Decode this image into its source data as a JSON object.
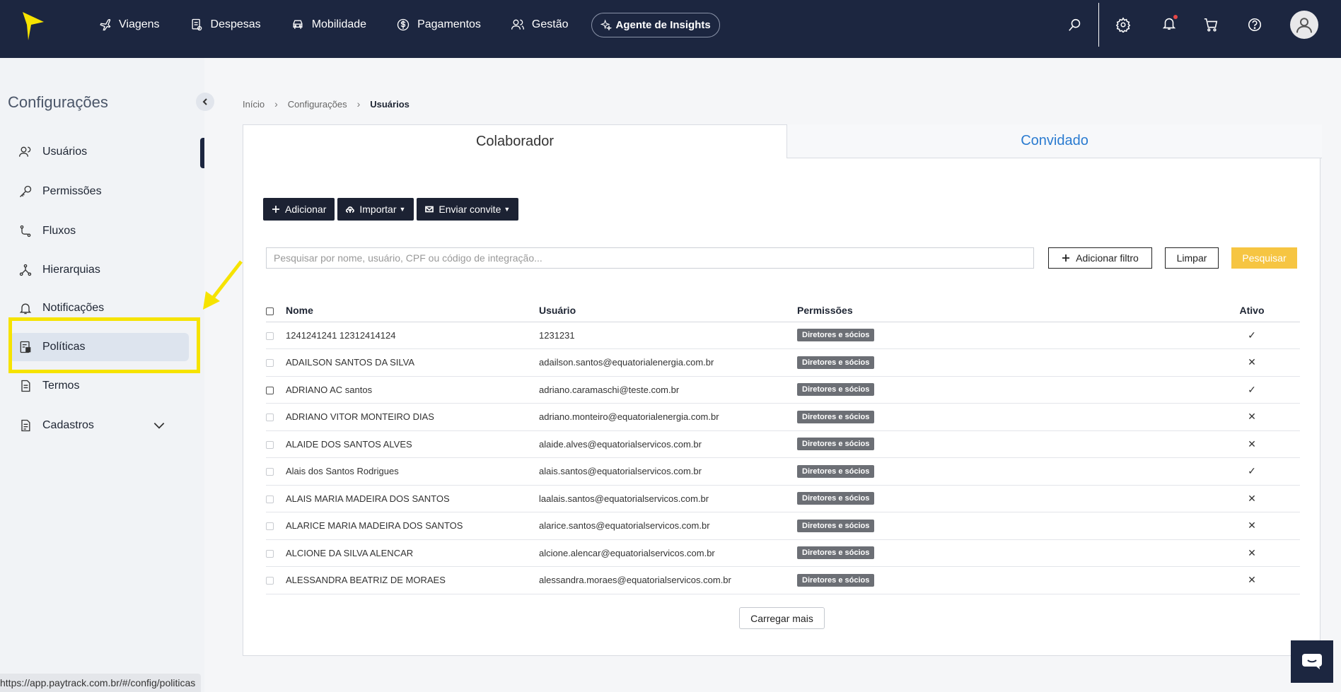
{
  "topnav": {
    "items": [
      {
        "label": "Viagens",
        "icon": "plane-icon"
      },
      {
        "label": "Despesas",
        "icon": "receipt-icon"
      },
      {
        "label": "Mobilidade",
        "icon": "car-icon"
      },
      {
        "label": "Pagamentos",
        "icon": "dollar-icon"
      },
      {
        "label": "Gestão",
        "icon": "users-icon"
      }
    ],
    "insights_label": "Agente de Insights"
  },
  "sidebar": {
    "title": "Configurações",
    "items": [
      {
        "label": "Usuários",
        "icon": "users-icon"
      },
      {
        "label": "Permissões",
        "icon": "key-icon"
      },
      {
        "label": "Fluxos",
        "icon": "flow-icon"
      },
      {
        "label": "Hierarquias",
        "icon": "hierarchy-icon"
      },
      {
        "label": "Notificações",
        "icon": "bell-icon"
      },
      {
        "label": "Políticas",
        "icon": "policy-icon"
      },
      {
        "label": "Termos",
        "icon": "document-icon"
      },
      {
        "label": "Cadastros",
        "icon": "register-icon"
      }
    ]
  },
  "breadcrumb": {
    "home": "Início",
    "config": "Configurações",
    "current": "Usuários"
  },
  "tabs": {
    "colaborador": "Colaborador",
    "convidado": "Convidado"
  },
  "actions": {
    "add": "Adicionar",
    "import": "Importar",
    "invite": "Enviar convite"
  },
  "search": {
    "placeholder": "Pesquisar por nome, usuário, CPF ou código de integração...",
    "add_filter": "Adicionar filtro",
    "clear": "Limpar",
    "submit": "Pesquisar"
  },
  "table": {
    "headers": {
      "name": "Nome",
      "user": "Usuário",
      "permissions": "Permissões",
      "active": "Ativo"
    },
    "rows": [
      {
        "name": "1241241241 12312414124",
        "user": "1231231",
        "permission": "Diretores e sócios",
        "active": "✓"
      },
      {
        "name": "ADAILSON SANTOS DA SILVA",
        "user": "adailson.santos@equatorialenergia.com.br",
        "permission": "Diretores e sócios",
        "active": "✕"
      },
      {
        "name": "ADRIANO AC santos",
        "user": "adriano.caramaschi@teste.com.br",
        "permission": "Diretores e sócios",
        "active": "✓"
      },
      {
        "name": "ADRIANO VITOR MONTEIRO DIAS",
        "user": "adriano.monteiro@equatorialenergia.com.br",
        "permission": "Diretores e sócios",
        "active": "✕"
      },
      {
        "name": "ALAIDE DOS SANTOS ALVES",
        "user": "alaide.alves@equatorialservicos.com.br",
        "permission": "Diretores e sócios",
        "active": "✕"
      },
      {
        "name": "Alais dos Santos Rodrigues",
        "user": "alais.santos@equatorialservicos.com.br",
        "permission": "Diretores e sócios",
        "active": "✓"
      },
      {
        "name": "ALAIS MARIA MADEIRA DOS SANTOS",
        "user": "laalais.santos@equatorialservicos.com.br",
        "permission": "Diretores e sócios",
        "active": "✕"
      },
      {
        "name": "ALARICE MARIA MADEIRA DOS SANTOS",
        "user": "alarice.santos@equatorialservicos.com.br",
        "permission": "Diretores e sócios",
        "active": "✕"
      },
      {
        "name": "ALCIONE DA SILVA ALENCAR",
        "user": "alcione.alencar@equatorialservicos.com.br",
        "permission": "Diretores e sócios",
        "active": "✕"
      },
      {
        "name": "ALESSANDRA BEATRIZ DE MORAES",
        "user": "alessandra.moraes@equatorialservicos.com.br",
        "permission": "Diretores e sócios",
        "active": "✕"
      }
    ]
  },
  "load_more": "Carregar mais",
  "status_url": "https://app.paytrack.com.br/#/config/politicas",
  "colors": {
    "nav_bg": "#1c2640",
    "highlight": "#f6e300",
    "search_btn": "#f6c542",
    "tab_link": "#2a7bd0"
  }
}
